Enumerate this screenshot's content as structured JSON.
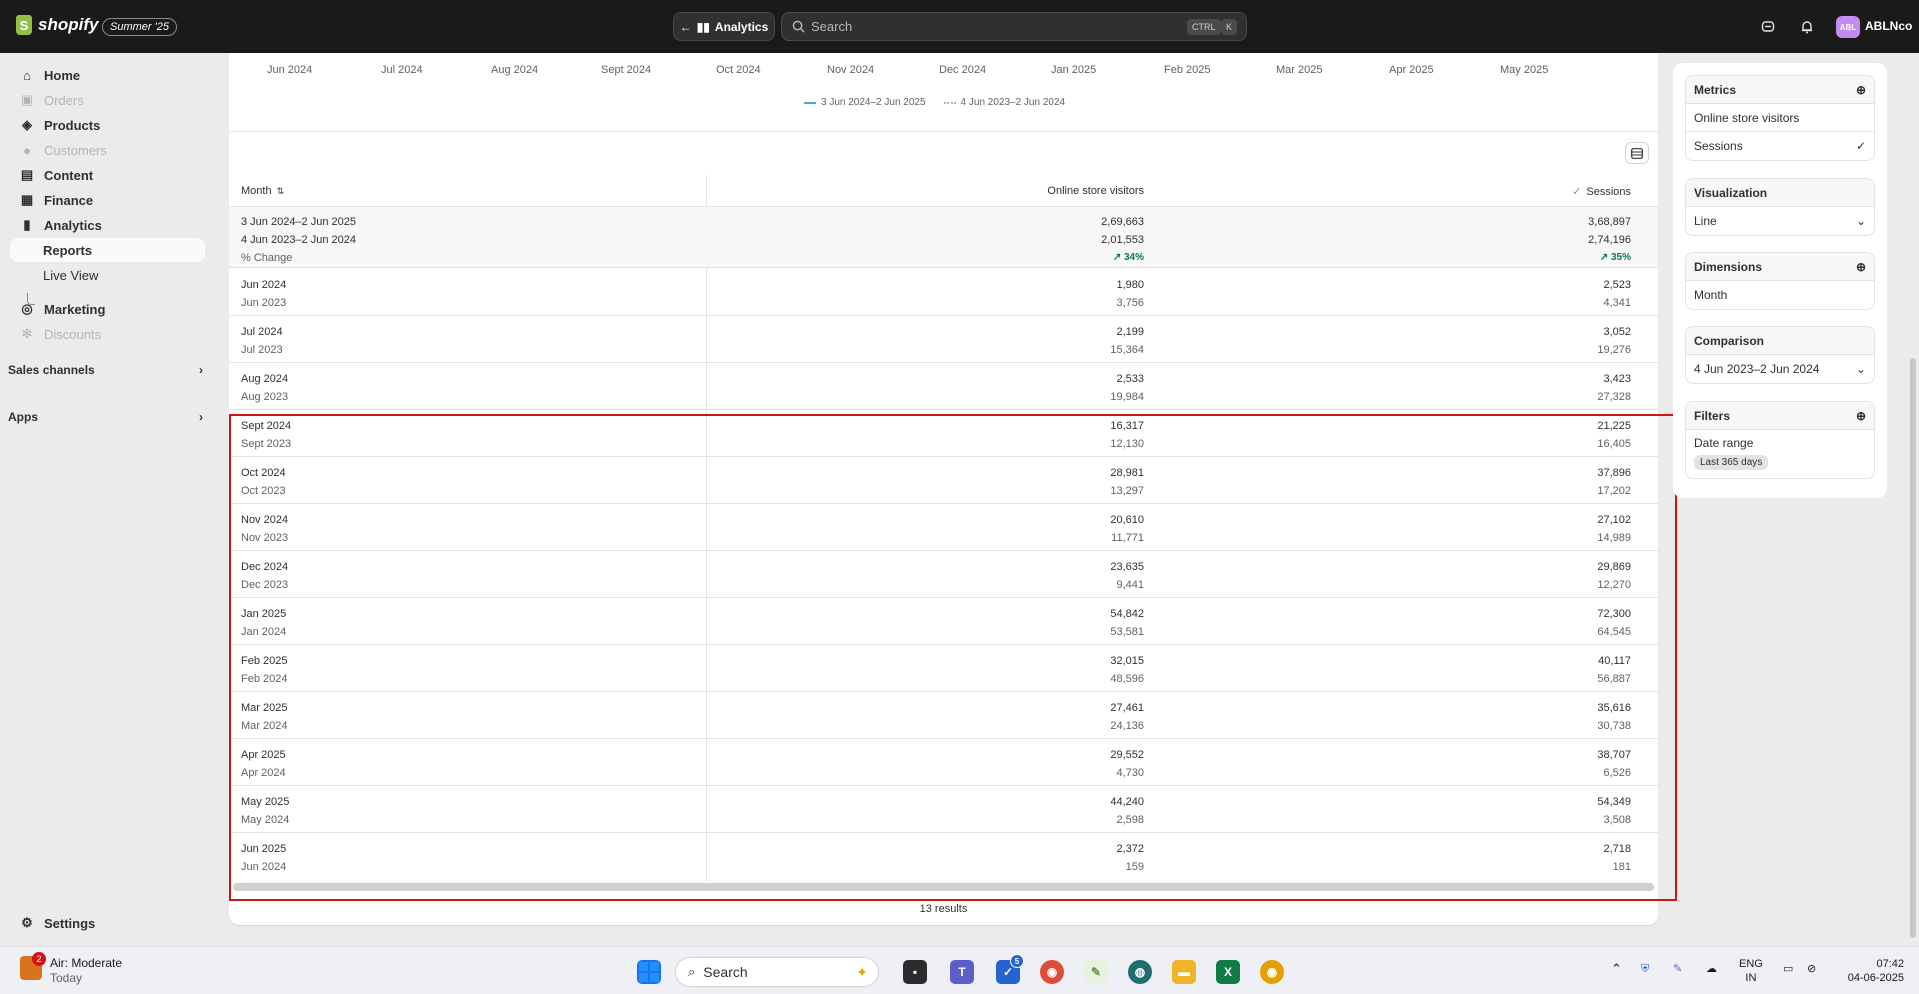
{
  "topbar": {
    "logo_text": "shopify",
    "logo_glyph": "S",
    "badge": "Summer '25",
    "analytics_label": "Analytics",
    "search_placeholder": "Search",
    "kbd_ctrl": "CTRL",
    "kbd_k": "K",
    "avatar_initials": "ABL",
    "store_name": "ABLNco"
  },
  "sidebar": {
    "items": [
      {
        "label": "Home",
        "icon": "home-icon"
      },
      {
        "label": "Orders",
        "icon": "inbox-icon"
      },
      {
        "label": "Products",
        "icon": "tag-icon"
      },
      {
        "label": "Customers",
        "icon": "person-icon"
      },
      {
        "label": "Content",
        "icon": "content-icon"
      },
      {
        "label": "Finance",
        "icon": "bank-icon"
      },
      {
        "label": "Analytics",
        "icon": "chart-icon"
      },
      {
        "label": "Reports"
      },
      {
        "label": "Live View"
      },
      {
        "label": "Marketing",
        "icon": "target-icon"
      },
      {
        "label": "Discounts",
        "icon": "discount-icon"
      }
    ],
    "sales_channels": "Sales channels",
    "apps": "Apps",
    "settings": "Settings"
  },
  "chart": {
    "x_ticks": [
      "Jun 2024",
      "Jul 2024",
      "Aug 2024",
      "Sept 2024",
      "Oct 2024",
      "Nov 2024",
      "Dec 2024",
      "Jan 2025",
      "Feb 2025",
      "Mar 2025",
      "Apr 2025",
      "May 2025"
    ],
    "legend_current": "3 Jun 2024–2 Jun 2025",
    "legend_previous": "4 Jun 2023–2 Jun 2024",
    "current_color": "#4fa6d3",
    "previous_color": "#b5b5b5"
  },
  "table": {
    "col_month": "Month",
    "col_visitors": "Online store visitors",
    "col_sessions": "Sessions",
    "totals": {
      "current_label": "3 Jun 2024–2 Jun 2025",
      "previous_label": "4 Jun 2023–2 Jun 2024",
      "change_label": "% Change",
      "visitors_current": "2,69,663",
      "visitors_previous": "2,01,553",
      "visitors_change": "34%",
      "sessions_current": "3,68,897",
      "sessions_previous": "2,74,196",
      "sessions_change": "35%"
    },
    "rows": [
      {
        "m1": "Jun 2024",
        "m2": "Jun 2023",
        "v1": "1,980",
        "v2": "3,756",
        "s1": "2,523",
        "s2": "4,341"
      },
      {
        "m1": "Jul 2024",
        "m2": "Jul 2023",
        "v1": "2,199",
        "v2": "15,364",
        "s1": "3,052",
        "s2": "19,276"
      },
      {
        "m1": "Aug 2024",
        "m2": "Aug 2023",
        "v1": "2,533",
        "v2": "19,984",
        "s1": "3,423",
        "s2": "27,328"
      },
      {
        "m1": "Sept 2024",
        "m2": "Sept 2023",
        "v1": "16,317",
        "v2": "12,130",
        "s1": "21,225",
        "s2": "16,405"
      },
      {
        "m1": "Oct 2024",
        "m2": "Oct 2023",
        "v1": "28,981",
        "v2": "13,297",
        "s1": "37,896",
        "s2": "17,202"
      },
      {
        "m1": "Nov 2024",
        "m2": "Nov 2023",
        "v1": "20,610",
        "v2": "11,771",
        "s1": "27,102",
        "s2": "14,989"
      },
      {
        "m1": "Dec 2024",
        "m2": "Dec 2023",
        "v1": "23,635",
        "v2": "9,441",
        "s1": "29,869",
        "s2": "12,270"
      },
      {
        "m1": "Jan 2025",
        "m2": "Jan 2024",
        "v1": "54,842",
        "v2": "53,581",
        "s1": "72,300",
        "s2": "64,545"
      },
      {
        "m1": "Feb 2025",
        "m2": "Feb 2024",
        "v1": "32,015",
        "v2": "48,596",
        "s1": "40,117",
        "s2": "56,887"
      },
      {
        "m1": "Mar 2025",
        "m2": "Mar 2024",
        "v1": "27,461",
        "v2": "24,136",
        "s1": "35,616",
        "s2": "30,738"
      },
      {
        "m1": "Apr 2025",
        "m2": "Apr 2024",
        "v1": "29,552",
        "v2": "4,730",
        "s1": "38,707",
        "s2": "6,526"
      },
      {
        "m1": "May 2025",
        "m2": "May 2024",
        "v1": "44,240",
        "v2": "2,598",
        "s1": "54,349",
        "s2": "3,508"
      },
      {
        "m1": "Jun 2025",
        "m2": "Jun 2024",
        "v1": "2,372",
        "v2": "159",
        "s1": "2,718",
        "s2": "181"
      }
    ],
    "results": "13 results"
  },
  "panel": {
    "metrics_title": "Metrics",
    "metric_1": "Online store visitors",
    "metric_2": "Sessions",
    "viz_title": "Visualization",
    "viz_value": "Line",
    "dim_title": "Dimensions",
    "dim_value": "Month",
    "cmp_title": "Comparison",
    "cmp_value": "4 Jun 2023–2 Jun 2024",
    "filters_title": "Filters",
    "filter_label": "Date range",
    "filter_chip": "Last 365 days"
  },
  "taskbar": {
    "weather_title": "Air: Moderate",
    "weather_sub": "Today",
    "weather_badge": "2",
    "search": "Search",
    "todo_badge": "5",
    "lang1": "ENG",
    "lang2": "IN",
    "time": "07:42",
    "date": "04-06-2025"
  },
  "colors": {
    "highlight": "#d01313",
    "positive": "#0a7a46"
  }
}
